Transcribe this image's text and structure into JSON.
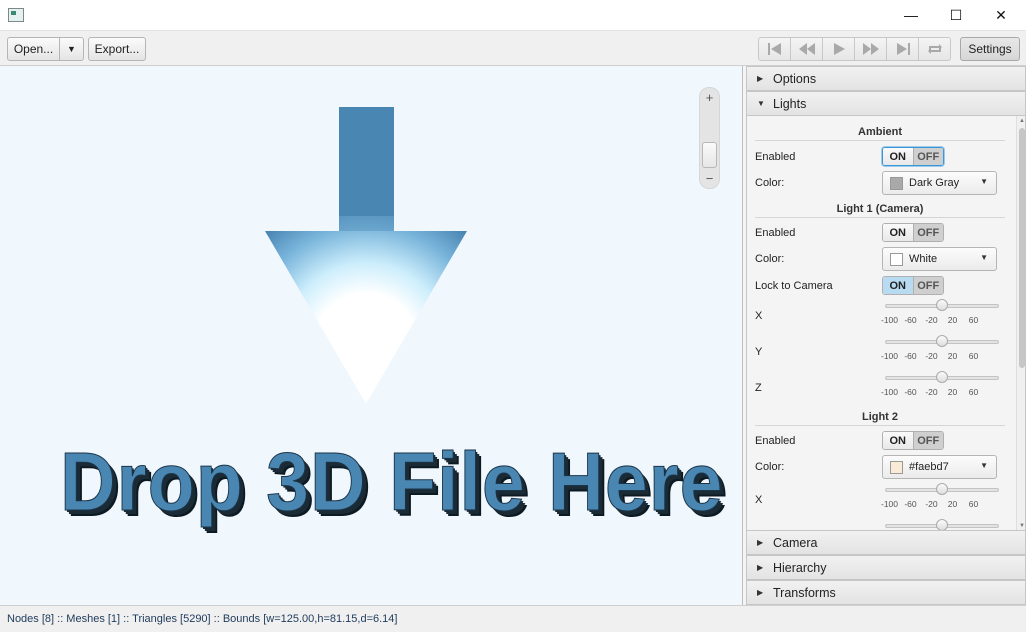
{
  "window": {
    "minimize_glyph": "—",
    "maximize_glyph": "☐",
    "close_glyph": "✕"
  },
  "toolbar": {
    "open_label": "Open...",
    "open_arrow": "▼",
    "export_label": "Export...",
    "media_icons": [
      "skip-to-start-icon",
      "rewind-icon",
      "play-icon",
      "fast-forward-icon",
      "skip-to-end-icon",
      "loop-icon"
    ],
    "settings_label": "Settings"
  },
  "viewport": {
    "drop_text": "Drop 3D File Here",
    "zoom_plus": "+",
    "zoom_minus": "−",
    "zoom_level": 0.45,
    "arrow_colors": {
      "top": "#4a86b2",
      "glow": "#ffffff"
    }
  },
  "panel": {
    "sections": {
      "options": "Options",
      "lights": "Lights",
      "camera": "Camera",
      "hierarchy": "Hierarchy",
      "transforms": "Transforms"
    },
    "ambient": {
      "title": "Ambient",
      "enabled_label": "Enabled",
      "on": "ON",
      "off": "OFF",
      "color_label": "Color:",
      "color_name": "Dark Gray",
      "color_hex": "#a9a9a9"
    },
    "light1": {
      "title": "Light 1 (Camera)",
      "enabled_label": "Enabled",
      "on": "ON",
      "off": "OFF",
      "color_label": "Color:",
      "color_name": "White",
      "color_hex": "#ffffff",
      "lock_label": "Lock to Camera",
      "lock_on": "ON",
      "lock_off": "OFF",
      "x_label": "X",
      "y_label": "Y",
      "z_label": "Z",
      "x_value": 0,
      "y_value": 0,
      "z_value": 0
    },
    "light2": {
      "title": "Light 2",
      "enabled_label": "Enabled",
      "on": "ON",
      "off": "OFF",
      "color_label": "Color:",
      "color_name": "#faebd7",
      "color_hex": "#faebd7",
      "x_label": "X",
      "x_value": 0
    },
    "slider_ticks": [
      "-100",
      "-60",
      "-20",
      "20",
      "60"
    ]
  },
  "status": {
    "text": "Nodes [8] :: Meshes [1] :: Triangles [5290] :: Bounds [w=125.00,h=81.15,d=6.14]"
  }
}
